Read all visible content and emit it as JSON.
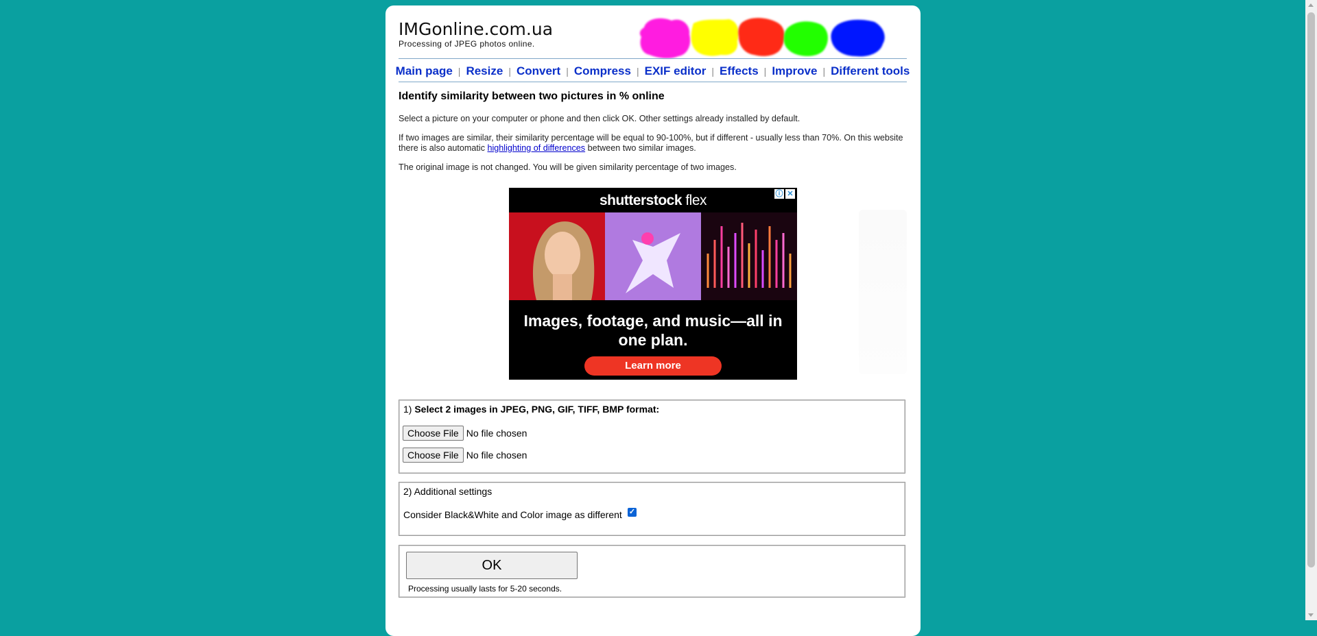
{
  "site": {
    "title": "IMGonline.com.ua",
    "subtitle": "Processing of JPEG photos online."
  },
  "nav": {
    "items": [
      {
        "label": "Main page"
      },
      {
        "label": "Resize"
      },
      {
        "label": "Convert"
      },
      {
        "label": "Compress"
      },
      {
        "label": "EXIF editor"
      },
      {
        "label": "Effects"
      },
      {
        "label": "Improve"
      },
      {
        "label": "Different tools"
      }
    ],
    "separator": "|"
  },
  "page": {
    "heading": "Identify similarity between two pictures in % online",
    "p1": "Select a picture on your computer or phone and then click OK. Other settings already installed by default.",
    "p2_before": "If two images are similar, their similarity percentage will be equal to 90-100%, but if different - usually less than 70%. On this website there is also automatic ",
    "p2_link": "highlighting of differences",
    "p2_after": " between two similar images.",
    "p3": "The original image is not changed. You will be given similarity percentage of two images."
  },
  "ad": {
    "brand": "shutterstock",
    "brand_suffix": "flex",
    "headline": "Images, footage, and music—all in one plan.",
    "cta": "Learn more",
    "info_icon": "info-icon",
    "close_icon": "close-icon"
  },
  "form": {
    "step1_prefix": "1) ",
    "step1_label": "Select 2 images in JPEG, PNG, GIF, TIFF, BMP format:",
    "file_button": "Choose File",
    "file_status": "No file chosen",
    "step2_label": "2) Additional settings",
    "checkbox_label": "Consider Black&White and Color image as different",
    "checkbox_checked": true,
    "ok_label": "OK",
    "ok_note": "Processing usually lasts for 5-20 seconds."
  },
  "colors": {
    "background": "#0aa0a0",
    "nav_link": "#0a2fc9",
    "ad_cta": "#ee3524",
    "checkbox": "#0b63d6"
  }
}
